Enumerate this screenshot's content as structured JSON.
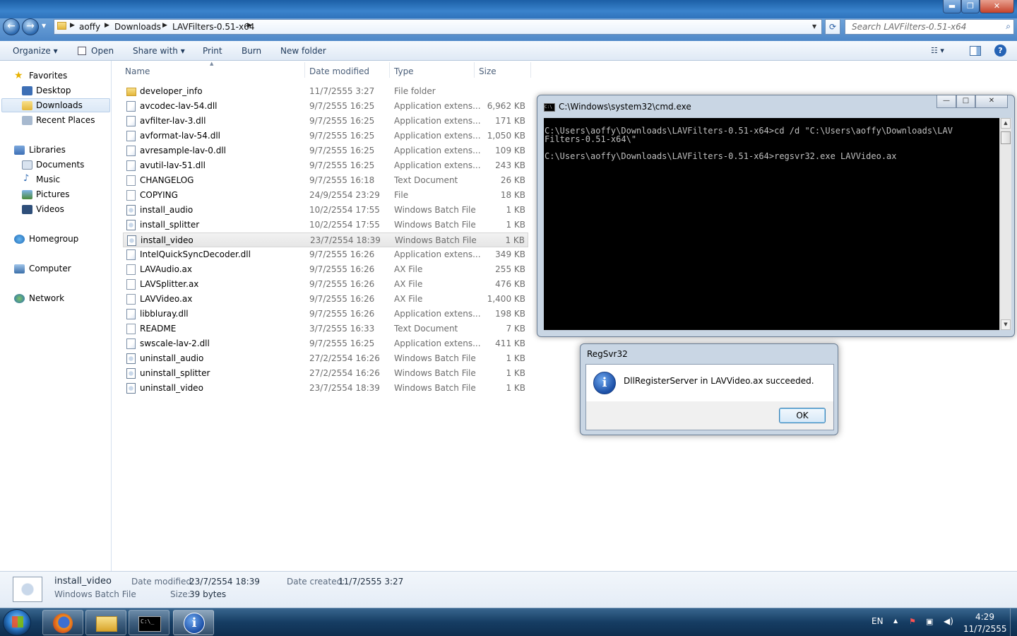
{
  "explorer": {
    "title_buttons": {
      "minimize": "▬",
      "maximize": "❐",
      "close": "✕"
    },
    "breadcrumb": [
      "aoffy",
      "Downloads",
      "LAVFilters-0.51-x64"
    ],
    "search_placeholder": "Search LAVFilters-0.51-x64",
    "toolbar": {
      "organize": "Organize",
      "open": "Open",
      "share_with": "Share with",
      "print": "Print",
      "burn": "Burn",
      "new_folder": "New folder"
    },
    "nav": {
      "favorites": "Favorites",
      "desktop": "Desktop",
      "downloads": "Downloads",
      "recent_places": "Recent Places",
      "libraries": "Libraries",
      "documents": "Documents",
      "music": "Music",
      "pictures": "Pictures",
      "videos": "Videos",
      "homegroup": "Homegroup",
      "computer": "Computer",
      "network": "Network"
    },
    "columns": {
      "name": "Name",
      "date": "Date modified",
      "type": "Type",
      "size": "Size"
    },
    "files": [
      {
        "name": "developer_info",
        "date": "11/7/2555 3:27",
        "type": "File folder",
        "size": "",
        "icon": "folder"
      },
      {
        "name": "avcodec-lav-54.dll",
        "date": "9/7/2555 16:25",
        "type": "Application extens...",
        "size": "6,962 KB",
        "icon": "dll"
      },
      {
        "name": "avfilter-lav-3.dll",
        "date": "9/7/2555 16:25",
        "type": "Application extens...",
        "size": "171 KB",
        "icon": "dll"
      },
      {
        "name": "avformat-lav-54.dll",
        "date": "9/7/2555 16:25",
        "type": "Application extens...",
        "size": "1,050 KB",
        "icon": "dll"
      },
      {
        "name": "avresample-lav-0.dll",
        "date": "9/7/2555 16:25",
        "type": "Application extens...",
        "size": "109 KB",
        "icon": "dll"
      },
      {
        "name": "avutil-lav-51.dll",
        "date": "9/7/2555 16:25",
        "type": "Application extens...",
        "size": "243 KB",
        "icon": "dll"
      },
      {
        "name": "CHANGELOG",
        "date": "9/7/2555 16:18",
        "type": "Text Document",
        "size": "26 KB",
        "icon": "doc"
      },
      {
        "name": "COPYING",
        "date": "24/9/2554 23:29",
        "type": "File",
        "size": "18 KB",
        "icon": "doc"
      },
      {
        "name": "install_audio",
        "date": "10/2/2554 17:55",
        "type": "Windows Batch File",
        "size": "1 KB",
        "icon": "bat"
      },
      {
        "name": "install_splitter",
        "date": "10/2/2554 17:55",
        "type": "Windows Batch File",
        "size": "1 KB",
        "icon": "bat"
      },
      {
        "name": "install_video",
        "date": "23/7/2554 18:39",
        "type": "Windows Batch File",
        "size": "1 KB",
        "icon": "bat",
        "selected": true
      },
      {
        "name": "IntelQuickSyncDecoder.dll",
        "date": "9/7/2555 16:26",
        "type": "Application extens...",
        "size": "349 KB",
        "icon": "dll"
      },
      {
        "name": "LAVAudio.ax",
        "date": "9/7/2555 16:26",
        "type": "AX File",
        "size": "255 KB",
        "icon": "doc"
      },
      {
        "name": "LAVSplitter.ax",
        "date": "9/7/2555 16:26",
        "type": "AX File",
        "size": "476 KB",
        "icon": "doc"
      },
      {
        "name": "LAVVideo.ax",
        "date": "9/7/2555 16:26",
        "type": "AX File",
        "size": "1,400 KB",
        "icon": "doc"
      },
      {
        "name": "libbluray.dll",
        "date": "9/7/2555 16:26",
        "type": "Application extens...",
        "size": "198 KB",
        "icon": "dll"
      },
      {
        "name": "README",
        "date": "3/7/2555 16:33",
        "type": "Text Document",
        "size": "7 KB",
        "icon": "doc"
      },
      {
        "name": "swscale-lav-2.dll",
        "date": "9/7/2555 16:25",
        "type": "Application extens...",
        "size": "411 KB",
        "icon": "dll"
      },
      {
        "name": "uninstall_audio",
        "date": "27/2/2554 16:26",
        "type": "Windows Batch File",
        "size": "1 KB",
        "icon": "bat"
      },
      {
        "name": "uninstall_splitter",
        "date": "27/2/2554 16:26",
        "type": "Windows Batch File",
        "size": "1 KB",
        "icon": "bat"
      },
      {
        "name": "uninstall_video",
        "date": "23/7/2554 18:39",
        "type": "Windows Batch File",
        "size": "1 KB",
        "icon": "bat"
      }
    ],
    "details": {
      "name": "install_video",
      "type": "Windows Batch File",
      "date_modified_label": "Date modified:",
      "date_modified": "23/7/2554 18:39",
      "size_label": "Size:",
      "size": "39 bytes",
      "date_created_label": "Date created:",
      "date_created": "11/7/2555 3:27"
    }
  },
  "cmd_window": {
    "title": "C:\\Windows\\system32\\cmd.exe",
    "icon_text": "C:\\",
    "lines": [
      "C:\\Users\\aoffy\\Downloads\\LAVFilters-0.51-x64>cd /d \"C:\\Users\\aoffy\\Downloads\\LAV",
      "Filters-0.51-x64\\\"",
      "",
      "C:\\Users\\aoffy\\Downloads\\LAVFilters-0.51-x64>regsvr32.exe LAVVideo.ax"
    ],
    "buttons": {
      "minimize": "—",
      "maximize": "□",
      "close": "✕"
    }
  },
  "dialog": {
    "title": "RegSvr32",
    "icon_glyph": "i",
    "message": "DllRegisterServer in LAVVideo.ax succeeded.",
    "ok": "OK"
  },
  "taskbar": {
    "language": "EN",
    "time": "4:29",
    "date": "11/7/2555",
    "cmd_icon_text": "C:\\_"
  }
}
